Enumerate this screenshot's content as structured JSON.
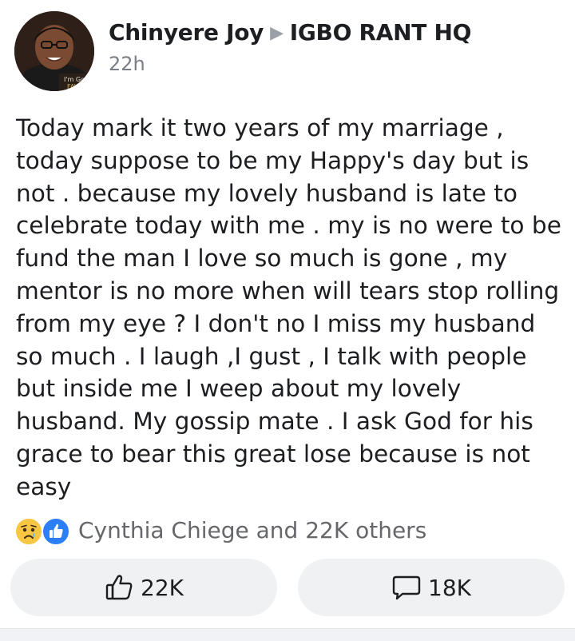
{
  "post": {
    "author": "Chinyere Joy",
    "group": "IGBO RANT HQ",
    "timestamp": "22h",
    "avatar_caption_line1": "I'm God",
    "avatar_caption_line2": "FAVO",
    "text": "Today mark it two years of my marriage , today suppose to be my Happy's day but is not . because my lovely husband is late to celebrate today with me . my is no were to be fund the man I love so much is gone , my mentor is no more when will tears stop rolling from my eye ? I don't no I miss my husband so much . I laugh ,I gust , I talk with people but inside me I weep about my lovely husband. My gossip mate . I ask God for his grace to bear this great lose because is not easy"
  },
  "reactions": {
    "summary": "Cynthia Chiege and 22K others",
    "icons": [
      "sad-icon",
      "like-icon"
    ]
  },
  "actions": {
    "like_count": "22K",
    "comment_count": "18K"
  },
  "colors": {
    "button_bg": "#eff1f3",
    "like_blue": "#2d7ff9",
    "sad_yellow": "#f7c744",
    "secondary_text": "#65676b"
  }
}
